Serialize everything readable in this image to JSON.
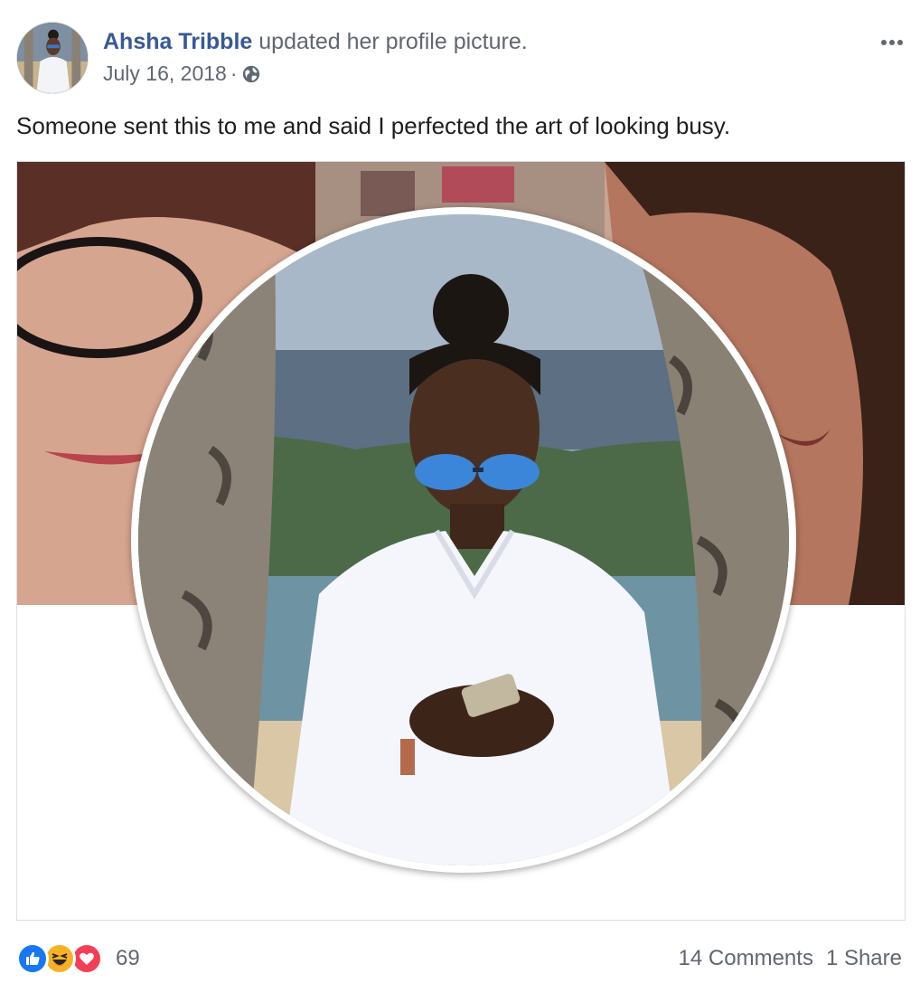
{
  "post": {
    "author": "Ahsha Tribble",
    "action": "updated her profile picture.",
    "date": "July 16, 2018",
    "separator": "·",
    "caption": "Someone sent this to me and said I perfected the art of looking busy."
  },
  "reactions": {
    "types": [
      "like",
      "haha",
      "love"
    ],
    "count": "69"
  },
  "footer": {
    "comments": "14 Comments",
    "shares": "1 Share"
  },
  "colors": {
    "link": "#385898",
    "meta": "#616770",
    "like": "#1877f2",
    "haha": "#f7b125",
    "love": "#f33e58"
  },
  "icons": {
    "privacy": "globe-icon",
    "menu": "more-options-icon"
  }
}
